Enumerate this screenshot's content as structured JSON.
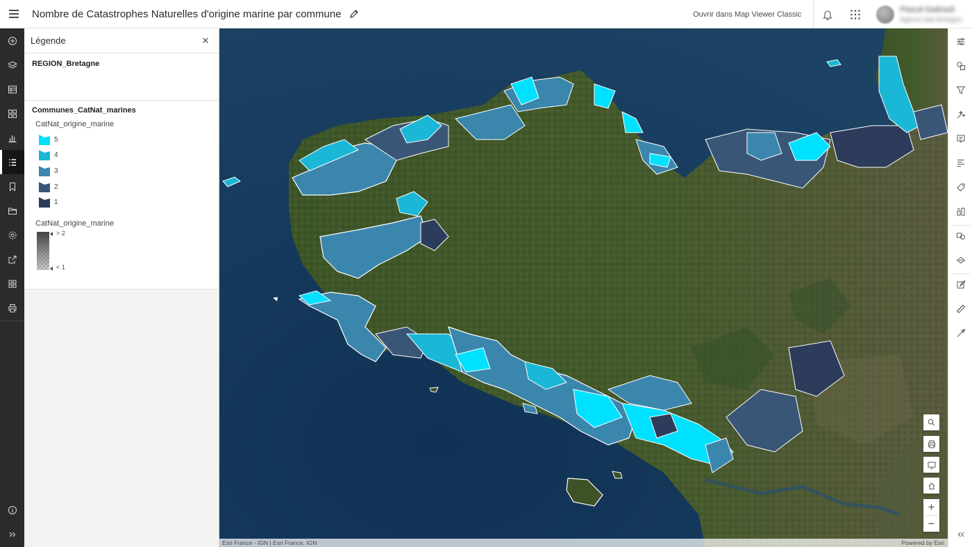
{
  "header": {
    "title": "Nombre de Catastrophes Naturelles d'origine marine par commune",
    "open_classic": "Ouvrir dans Map Viewer Classic",
    "user_name": "Pascal Gadrault",
    "user_org": "Agence data Bretagne"
  },
  "left_bar": {
    "items": [
      "add-icon",
      "layers-icon",
      "table-icon",
      "basemap-icon",
      "charts-icon",
      "legend-icon",
      "bookmarks-icon",
      "folder-icon",
      "settings-icon",
      "share-icon",
      "apps-icon",
      "print-icon"
    ],
    "active": "legend-icon",
    "bottom": [
      "info-icon",
      "expand-icon"
    ]
  },
  "legend": {
    "title": "Légende",
    "layer1": {
      "name": "REGION_Bretagne"
    },
    "layer2": {
      "name": "Communes_CatNat_marines",
      "field": "CatNat_origine_marine",
      "classes": [
        {
          "label": "5",
          "color": "#00e0ff"
        },
        {
          "label": "4",
          "color": "#1ab8d6"
        },
        {
          "label": "3",
          "color": "#3b86ad"
        },
        {
          "label": "2",
          "color": "#3a5677"
        },
        {
          "label": "1",
          "color": "#2d3c5a"
        }
      ],
      "field2": "CatNat_origine_marine",
      "ramp_high": "> 2",
      "ramp_low": "< 1"
    }
  },
  "map": {
    "attribution_left": "Esri France - IGN | Esri France, IGN",
    "attribution_right": "Powered by Esri",
    "sea_color": "#173a5b",
    "land_color": "#3e5127"
  },
  "map_controls": [
    "search-icon",
    "print-map-icon",
    "fullscreen-icon",
    "home-icon",
    "zoom-in-icon",
    "zoom-out-icon"
  ],
  "right_bar": {
    "items": [
      "properties-icon",
      "styles-icon",
      "filter-icon",
      "effects-icon",
      "popups-icon",
      "fields-icon",
      "labels-icon",
      "configure-icon",
      "sketch-icon",
      "analysis-icon",
      "edit-icon",
      "measure-icon",
      "directions-icon",
      "tools-icon"
    ],
    "bottom": [
      "collapse-icon"
    ]
  }
}
